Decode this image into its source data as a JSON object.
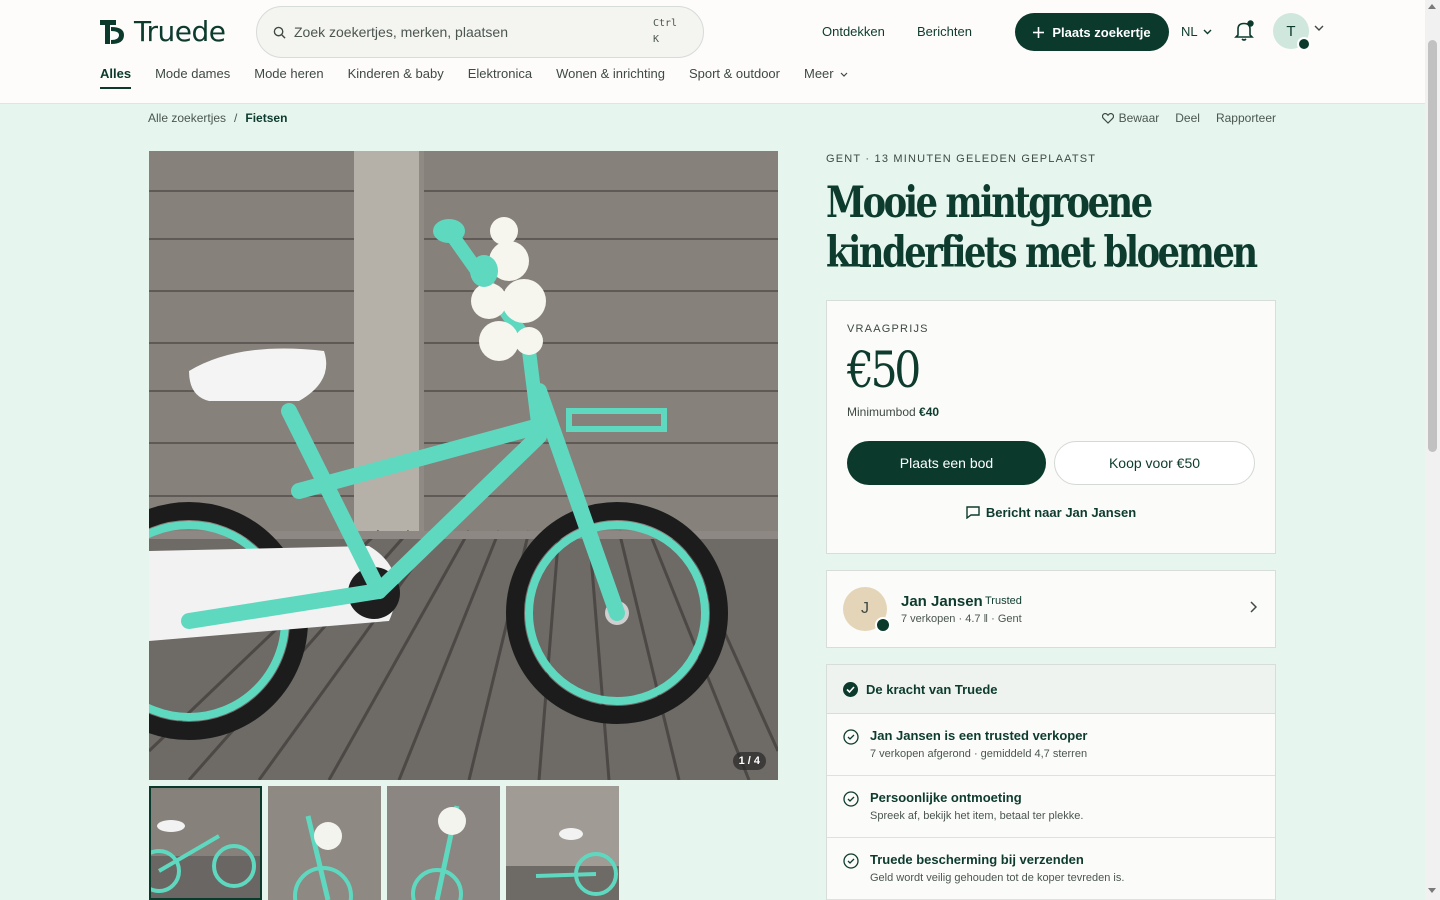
{
  "header": {
    "logo_text": "Truede",
    "search": {
      "placeholder": "Zoek zoekertjes, merken, plaatsen",
      "shortcut_line1": "Ctrl",
      "shortcut_line2": "K"
    },
    "links": [
      "Ontdekken",
      "Berichten"
    ],
    "post_button": "Plaats zoekertje",
    "language": "NL",
    "user_initial": "T"
  },
  "categories": [
    {
      "label": "Alles",
      "active": true
    },
    {
      "label": "Mode dames"
    },
    {
      "label": "Mode heren"
    },
    {
      "label": "Kinderen & baby"
    },
    {
      "label": "Elektronica"
    },
    {
      "label": "Wonen & inrichting"
    },
    {
      "label": "Sport & outdoor"
    },
    {
      "label": "Meer"
    }
  ],
  "breadcrumb": {
    "root": "Alle zoekertjes",
    "separator": "/",
    "current": "Fietsen"
  },
  "actions": {
    "save": "Bewaar",
    "share": "Deel",
    "report": "Rapporteer"
  },
  "gallery": {
    "counter": "1 / 4",
    "thumb_count": 4
  },
  "listing": {
    "meta": "GENT · 13 MINUTEN GELEDEN GEPLAATST",
    "title_line1": "Mooie mintgroene",
    "title_line2": "kinderfiets met bloemen"
  },
  "price_card": {
    "label": "VRAAGPRIJS",
    "price": "€50",
    "min_bid_label": "Minimumbod",
    "min_bid_value": "€40",
    "bid_button": "Plaats een bod",
    "buy_button": "Koop voor €50",
    "message_link": "Bericht naar Jan Jansen"
  },
  "seller": {
    "initial": "J",
    "name": "Jan Jansen",
    "badge": "Trusted",
    "stats": "7 verkopen · 4.7 ‖ · Gent"
  },
  "trust": {
    "heading": "De kracht van Truede",
    "items": [
      {
        "title": "Jan Jansen is een trusted verkoper",
        "subtitle": "7 verkopen afgerond · gemiddeld 4,7 sterren"
      },
      {
        "title": "Persoonlijke ontmoeting",
        "subtitle": "Spreek af, bekijk het item, betaal ter plekke."
      },
      {
        "title": "Truede bescherming bij verzenden",
        "subtitle": "Geld wordt veilig gehouden tot de koper tevreden is."
      }
    ]
  },
  "colors": {
    "brand": "#0b3a2c",
    "page_bg": "#e6f6ee",
    "bike_mint": "#5fd8c0"
  }
}
